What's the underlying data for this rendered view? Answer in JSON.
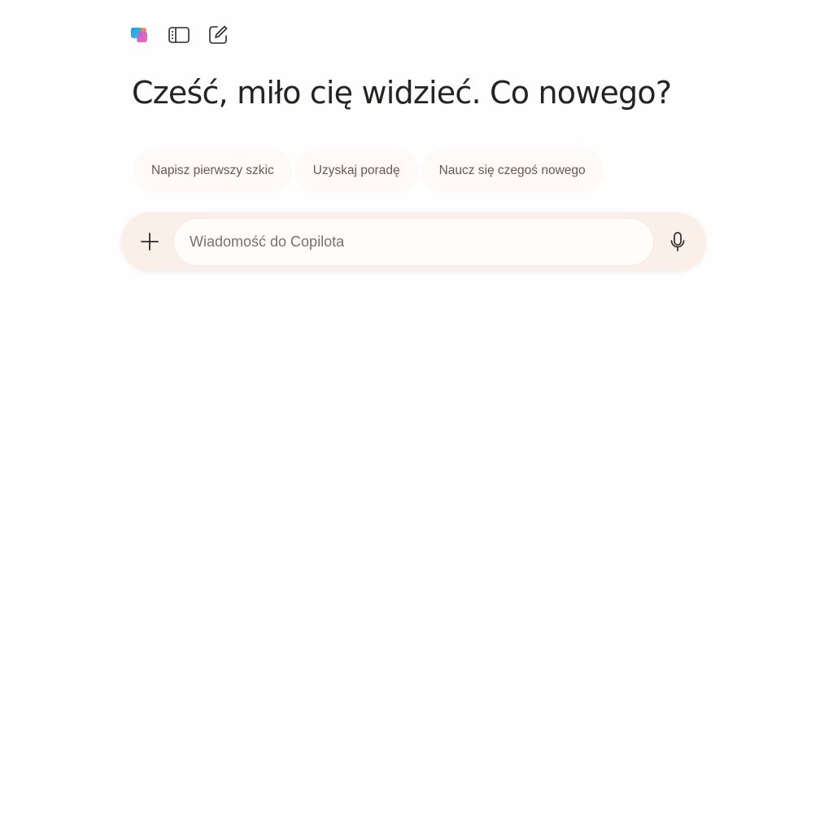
{
  "toolbar": {
    "icons": [
      "copilot-logo-icon",
      "sidebar-toggle-icon",
      "new-chat-icon"
    ]
  },
  "greeting": "Cześć, miło cię widzieć. Co nowego?",
  "suggestions": [
    {
      "label": "Napisz pierwszy szkic"
    },
    {
      "label": "Uzyskaj poradę"
    },
    {
      "label": "Naucz się czegoś nowego"
    }
  ],
  "composer": {
    "placeholder": "Wiadomość do Copilota",
    "value": "",
    "add_icon": "plus-icon",
    "mic_icon": "microphone-icon"
  },
  "colors": {
    "background": "#ffffff",
    "composer_bg": "#fbefea",
    "chip_bg": "#fffaf8",
    "heading_text": "#262322",
    "chip_text": "#6a5652"
  }
}
